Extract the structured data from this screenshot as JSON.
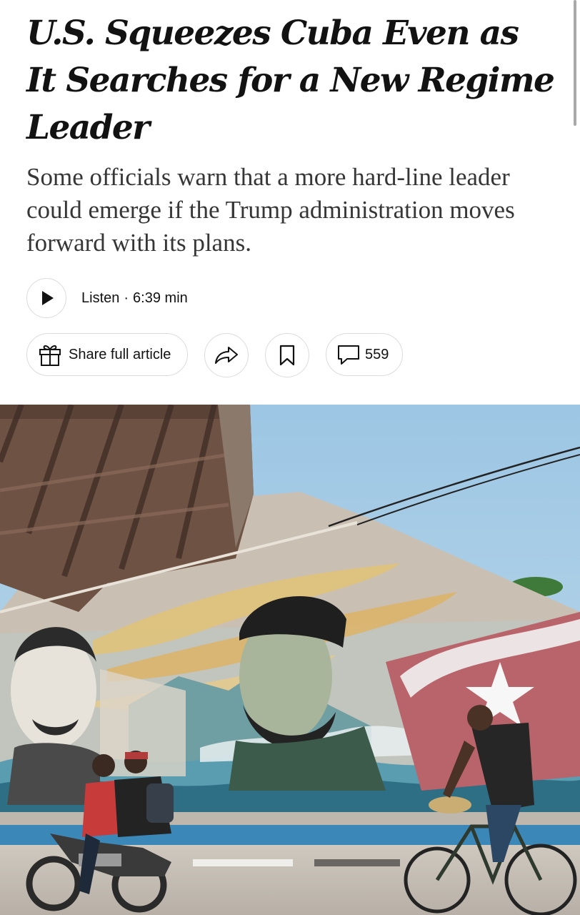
{
  "article": {
    "headline": "U.S. Squeezes Cuba Even as It Searches for a New Regime Leader",
    "dek": "Some officials warn that a more hard-line leader could emerge if the Trump administration moves forward with its plans."
  },
  "audio": {
    "listen_label": "Listen",
    "separator": "·",
    "duration": "6:39 min",
    "play_icon": "play-icon"
  },
  "toolbar": {
    "share_label": "Share full article",
    "share_icon": "gift-icon",
    "forward_icon": "share-arrow-icon",
    "save_icon": "bookmark-icon",
    "comment_icon": "comment-icon",
    "comment_count": "559"
  },
  "media": {
    "subject": "Street mural of revolutionary figures and a Cuban flag under an overpass, with people on a motorcycle and a bicycle passing by",
    "colors": {
      "sky": "#a8cde6",
      "overpass": "#6e5244",
      "curb": "#3b88b8"
    }
  }
}
